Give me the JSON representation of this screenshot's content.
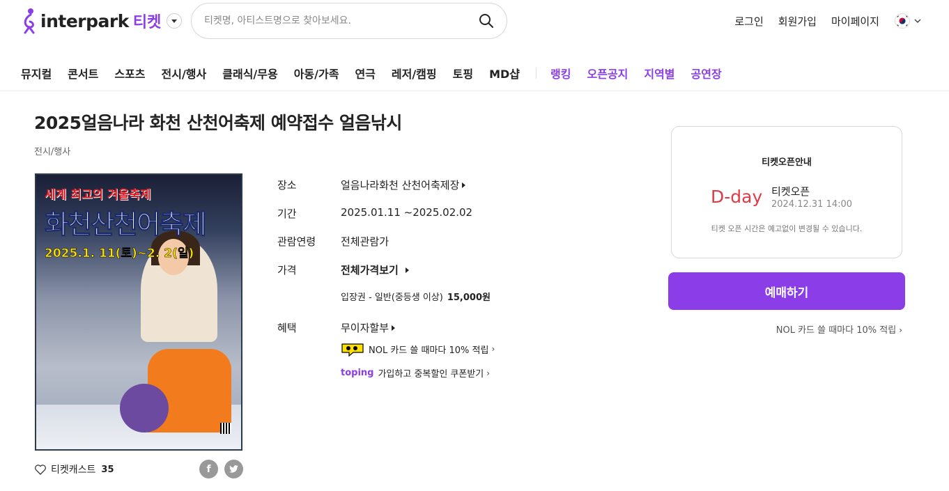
{
  "header": {
    "logo_text": "interpark",
    "logo_ticket": "티켓",
    "search_placeholder": "티켓명, 아티스트명으로 찾아보세요.",
    "user_menu": [
      "로그인",
      "회원가입",
      "마이페이지"
    ]
  },
  "nav": {
    "categories": [
      "뮤지컬",
      "콘서트",
      "스포츠",
      "전시/행사",
      "클래식/무용",
      "아동/가족",
      "연극",
      "레저/캠핑",
      "토핑",
      "MD샵"
    ],
    "extras": [
      "랭킹",
      "오픈공지",
      "지역별",
      "공연장"
    ]
  },
  "product": {
    "title": "2025얼음나라 화천 산천어축제 예약접수 얼음낚시",
    "genre": "전시/행사",
    "poster": {
      "top_text": "세계 최고의 겨울축제",
      "main_text": "화천산천어축제",
      "date_text": "2025.1. 11(토)~2. 2(일)"
    },
    "cast_label": "티켓캐스트",
    "cast_count": "35",
    "share_facebook": "f",
    "share_twitter": "t"
  },
  "info": {
    "place_label": "장소",
    "place_value": "얼음나라화천 산천어축제장",
    "period_label": "기간",
    "period_value": "2025.01.11 ~2025.02.02",
    "age_label": "관람연령",
    "age_value": "전체관람가",
    "price_label": "가격",
    "price_value": "전체가격보기",
    "price_item": "입장권 - 일반(중등생 이상)",
    "price_amount": "15,000원",
    "benefit_label": "혜택",
    "benefit_value": "무이자할부",
    "nol_benefit": "NOL 카드 쓸 때마다 10% 적립",
    "toping_logo": "toping",
    "toping_benefit": "가입하고 중복할인 쿠폰받기"
  },
  "panel": {
    "title": "티켓오픈안내",
    "dday": "D-day",
    "open_label": "티켓오픈",
    "open_date": "2024.12.31 14:00",
    "note": "티켓 오픈 시간은 예고없이 변경될 수 있습니다."
  },
  "booking": {
    "button_label": "예매하기",
    "nol_promo": "NOL 카드 쓸 때마다 10% 적립"
  },
  "colors": {
    "brand": "#8b3ee8",
    "dday": "#e13a45"
  }
}
